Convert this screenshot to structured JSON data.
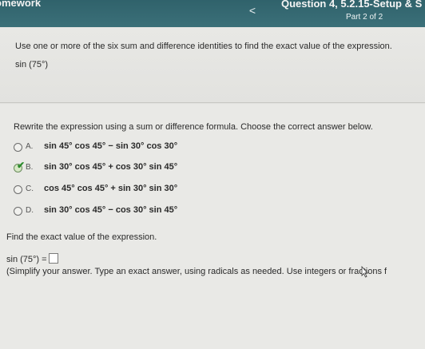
{
  "header": {
    "app_title": "omework",
    "question_title": "Question 4, 5.2.15-Setup & S",
    "part": "Part 2 of 2",
    "back_label": "<"
  },
  "problem": {
    "instruction": "Use one or more of the six sum and difference identities to find the exact value of the expression.",
    "expression": "sin (75°)"
  },
  "question": {
    "prompt": "Rewrite the expression using a sum or difference formula. Choose the correct answer below.",
    "options": [
      {
        "letter": "A.",
        "formula": "sin 45° cos 45° − sin 30° cos 30°",
        "selected": false
      },
      {
        "letter": "B.",
        "formula": "sin 30° cos 45° + cos 30° sin 45°",
        "selected": true
      },
      {
        "letter": "C.",
        "formula": "cos 45° cos 45° + sin 30° sin 30°",
        "selected": false
      },
      {
        "letter": "D.",
        "formula": "sin 30° cos 45° − cos 30° sin 45°",
        "selected": false
      }
    ]
  },
  "part2": {
    "find_text": "Find the exact value of the expression.",
    "answer_prefix": "sin (75°) =",
    "answer_value": "",
    "simplify_text": "(Simplify your answer. Type an exact answer, using radicals as needed. Use integers or fractions f"
  },
  "icons": {
    "back": "chevron-left-icon",
    "selected": "checkmark-icon",
    "cursor": "mouse-pointer-icon"
  }
}
